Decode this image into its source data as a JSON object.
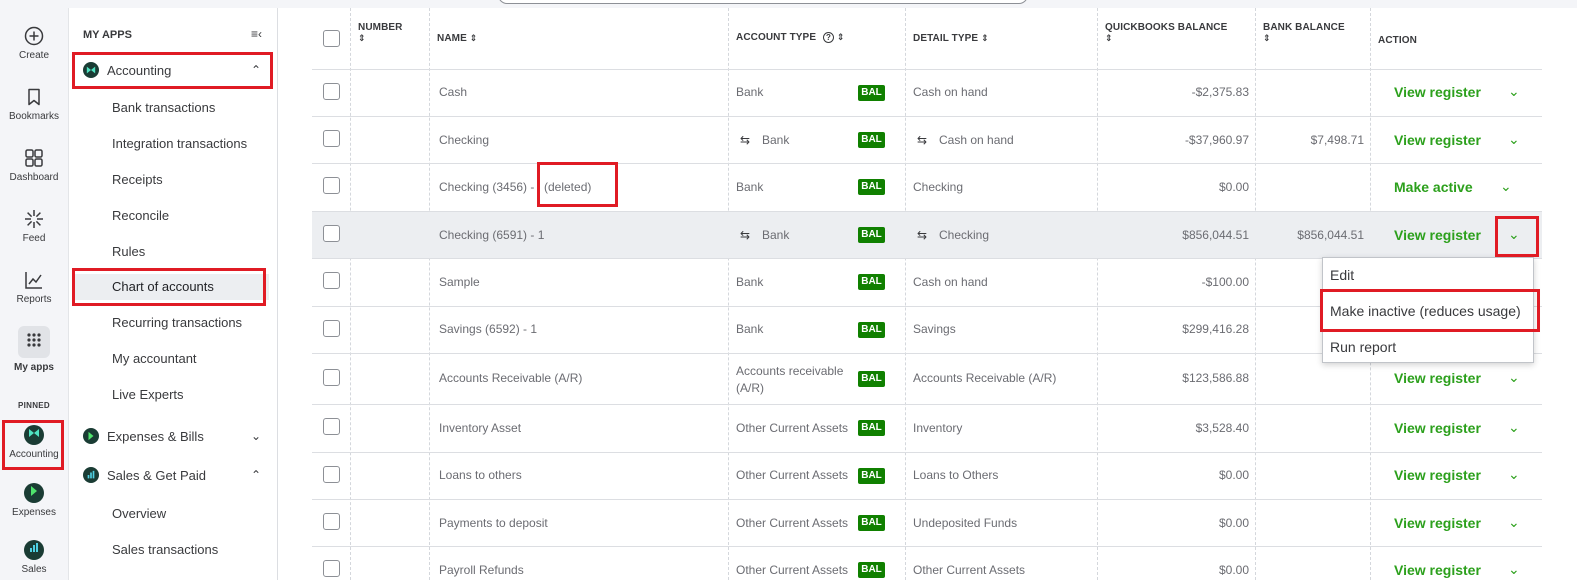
{
  "rail": {
    "create": "Create",
    "bookmarks": "Bookmarks",
    "dashboard": "Dashboard",
    "feed": "Feed",
    "reports": "Reports",
    "my_apps": "My apps",
    "pinned": "PINNED",
    "accounting": "Accounting",
    "expenses": "Expenses",
    "sales": "Sales"
  },
  "sidebar": {
    "header": "MY APPS",
    "groups": {
      "accounting": "Accounting",
      "expenses": "Expenses & Bills",
      "sales": "Sales & Get Paid"
    },
    "items": [
      "Bank transactions",
      "Integration transactions",
      "Receipts",
      "Reconcile",
      "Rules",
      "Chart of accounts",
      "Recurring transactions",
      "My accountant",
      "Live Experts"
    ],
    "sales_items": [
      "Overview",
      "Sales transactions"
    ]
  },
  "table": {
    "headers": {
      "number": "NUMBER",
      "name": "NAME",
      "account_type": "ACCOUNT TYPE",
      "detail_type": "DETAIL TYPE",
      "qb_balance": "QUICKBOOKS BALANCE",
      "bank_balance": "BANK BALANCE",
      "action": "ACTION"
    },
    "rows": [
      {
        "name": "Cash",
        "account_type": "Bank",
        "detail_type": "Cash on hand",
        "qb_balance": "-$2,375.83",
        "bank_balance": "",
        "action": "View register"
      },
      {
        "name": "Checking",
        "account_type": "Bank",
        "detail_type": "Cash on hand",
        "qb_balance": "-$37,960.97",
        "bank_balance": "$7,498.71",
        "action": "View register"
      },
      {
        "name": "Checking (3456) -",
        "name_suffix": "(deleted)",
        "account_type": "Bank",
        "detail_type": "Checking",
        "qb_balance": "$0.00",
        "bank_balance": "",
        "action": "Make active"
      },
      {
        "name": "Checking (6591) - 1",
        "account_type": "Bank",
        "detail_type": "Checking",
        "qb_balance": "$856,044.51",
        "bank_balance": "$856,044.51",
        "action": "View register"
      },
      {
        "name": "Sample",
        "account_type": "Bank",
        "detail_type": "Cash on hand",
        "qb_balance": "-$100.00",
        "bank_balance": "",
        "action": ""
      },
      {
        "name": "Savings (6592) - 1",
        "account_type": "Bank",
        "detail_type": "Savings",
        "qb_balance": "$299,416.28",
        "bank_balance": "",
        "action": ""
      },
      {
        "name": "Accounts Receivable (A/R)",
        "account_type": "Accounts receivable (A/R)",
        "detail_type": "Accounts Receivable (A/R)",
        "qb_balance": "$123,586.88",
        "bank_balance": "",
        "action": "View register"
      },
      {
        "name": "Inventory Asset",
        "account_type": "Other Current Assets",
        "detail_type": "Inventory",
        "qb_balance": "$3,528.40",
        "bank_balance": "",
        "action": "View register"
      },
      {
        "name": "Loans to others",
        "account_type": "Other Current Assets",
        "detail_type": "Loans to Others",
        "qb_balance": "$0.00",
        "bank_balance": "",
        "action": "View register"
      },
      {
        "name": "Payments to deposit",
        "account_type": "Other Current Assets",
        "detail_type": "Undeposited Funds",
        "qb_balance": "$0.00",
        "bank_balance": "",
        "action": "View register"
      },
      {
        "name": "Payroll Refunds",
        "account_type": "Other Current Assets",
        "detail_type": "Other Current Assets",
        "qb_balance": "$0.00",
        "bank_balance": "",
        "action": "View register"
      }
    ],
    "bal_label": "BAL"
  },
  "dropdown": {
    "items": [
      "Edit",
      "Make inactive (reduces usage)",
      "Run report"
    ]
  },
  "colors": {
    "accent": "#2ca01c",
    "bal_badge": "#108000",
    "annotation": "#e01b24"
  }
}
